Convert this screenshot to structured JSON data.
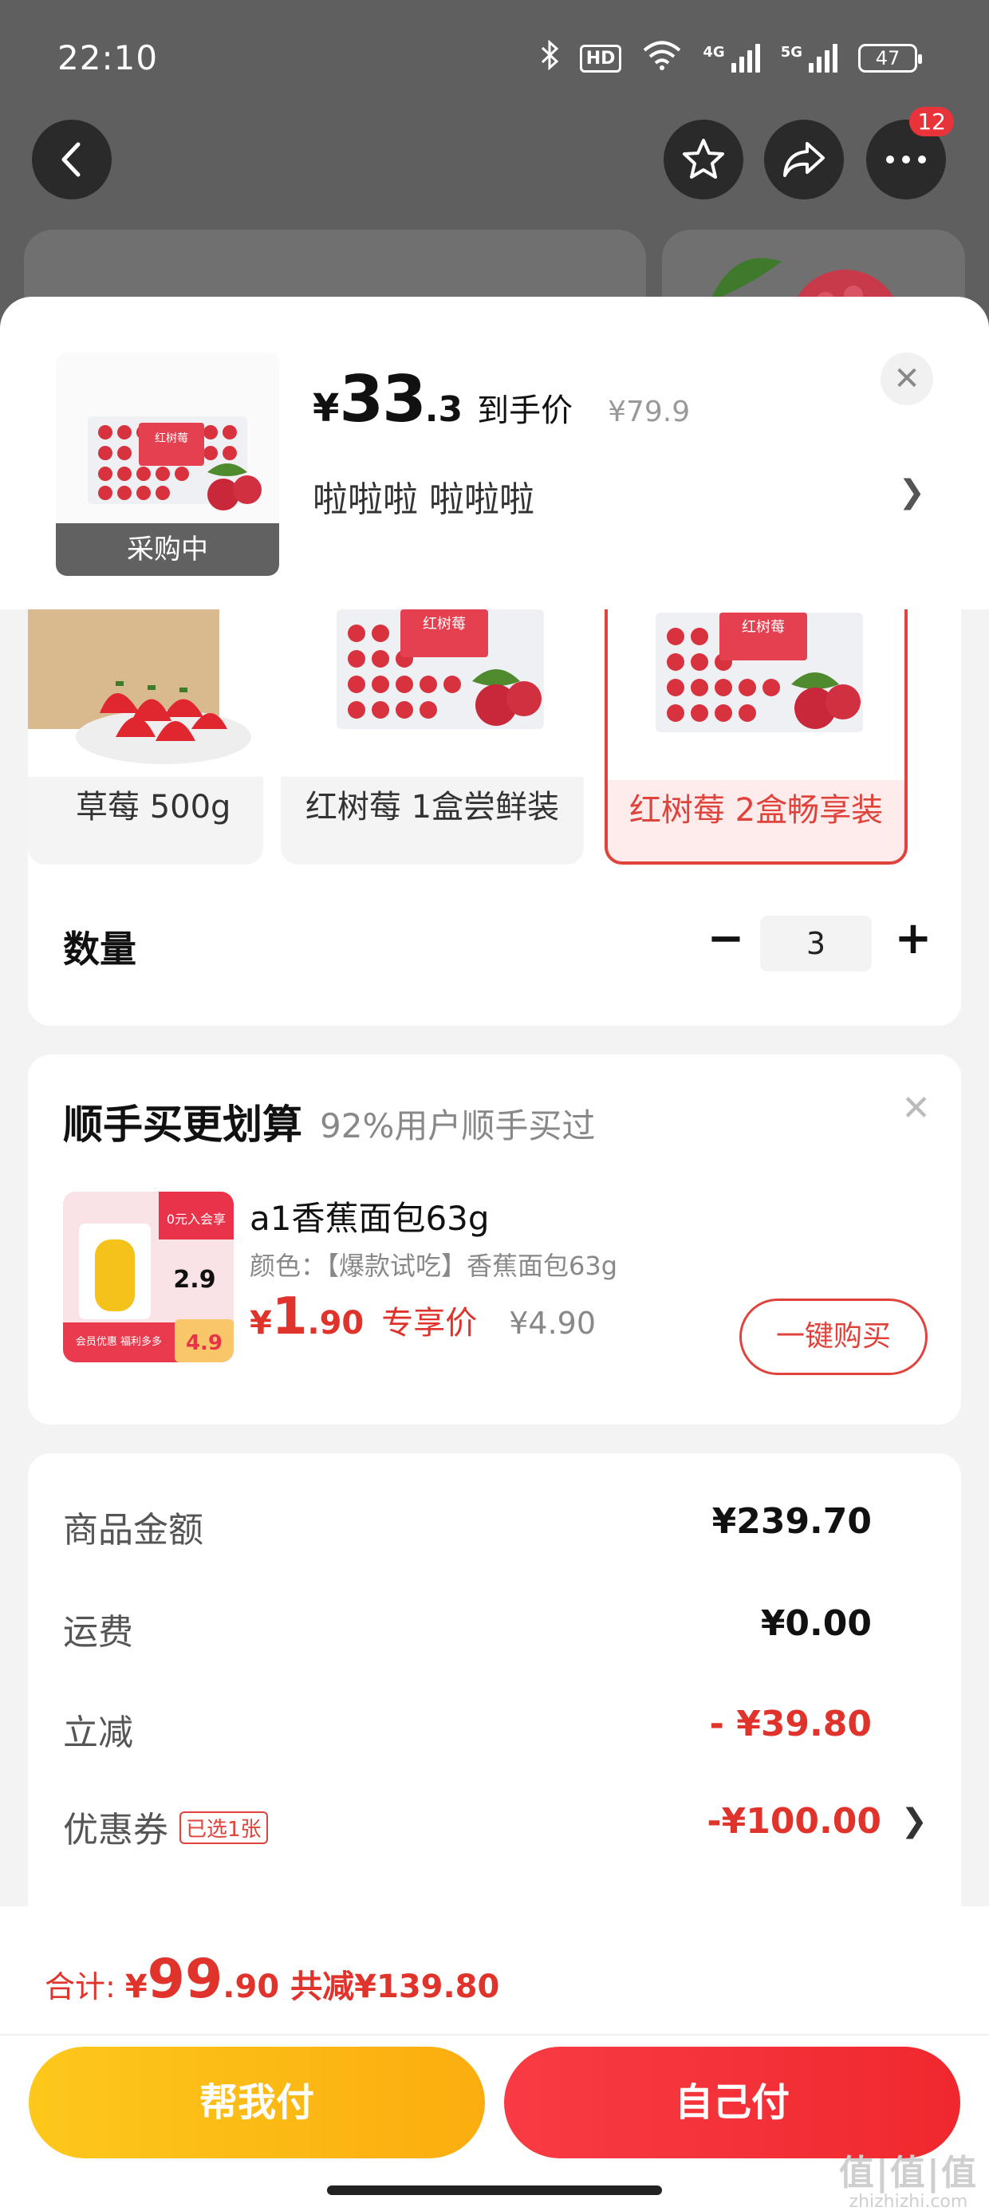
{
  "status_bar": {
    "time": "22:10",
    "hd_label": "HD",
    "sig1": "4G",
    "sig2": "5G",
    "battery": "47"
  },
  "header": {
    "more_badge": "12"
  },
  "product": {
    "price_currency": "¥",
    "price_int": "33",
    "price_dec": ".3",
    "price_label": "到手价",
    "original_price": "¥79.9",
    "spec_text": "啦啦啦  啦啦啦",
    "thumb_tag": "采购中",
    "box_label": "红树莓"
  },
  "options": [
    {
      "label": "草莓 500g",
      "selected": false
    },
    {
      "label": "红树莓 1盒尝鲜装",
      "selected": false
    },
    {
      "label": "红树莓 2盒畅享装",
      "selected": true
    }
  ],
  "quantity": {
    "label": "数量",
    "minus": "−",
    "plus": "+",
    "value": "3"
  },
  "addon": {
    "title": "顺手买更划算",
    "subtitle": "92%用户顺手买过",
    "name": "a1香蕉面包63g",
    "desc": "颜色：【爆款试吃】香蕉面包63g",
    "price_currency": "¥",
    "price_int": "1",
    "price_dec": ".90",
    "price_label": "专享价",
    "original_price": "¥4.90",
    "button": "一键购买",
    "img_banner": "0元入会享",
    "img_price": "2.9",
    "img_footer": "会员优惠 福利多多",
    "img_badge": "4.9"
  },
  "summary": {
    "rows": [
      {
        "label": "商品金额",
        "value": "¥239.70"
      },
      {
        "label": "运费",
        "value": "¥0.00"
      },
      {
        "label": "立减",
        "value": "- ¥39.80"
      },
      {
        "label": "优惠券",
        "value": "-¥100.00",
        "tag": "已选1张"
      }
    ]
  },
  "bottom": {
    "total_label": "合计:",
    "total_currency": "¥",
    "total_int": "99",
    "total_dec": ".90",
    "total_saving": "共减¥139.80",
    "help_pay": "帮我付",
    "self_pay": "自己付"
  },
  "watermark": {
    "text": "值|值|值",
    "sub": "zhizhizhi.com"
  },
  "colors": {
    "accent_red": "#e0332b",
    "yellow_button": "#fdc81b",
    "red_button": "#f83b44"
  }
}
